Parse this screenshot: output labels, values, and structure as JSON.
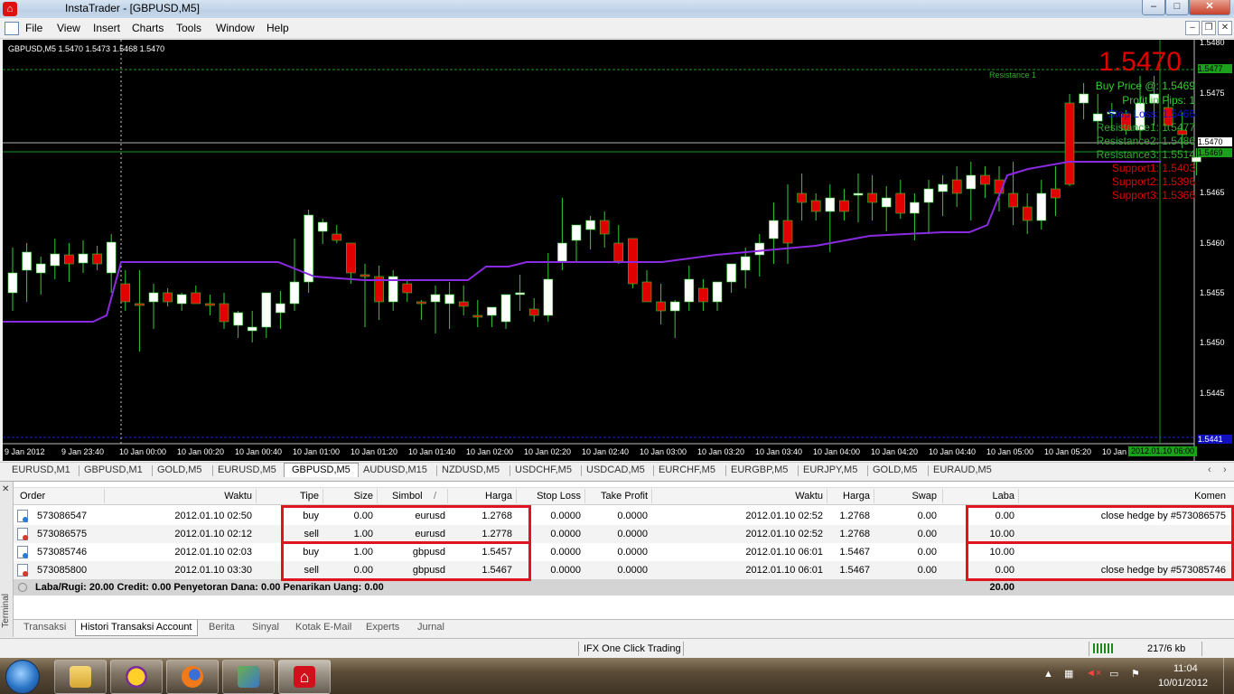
{
  "window": {
    "title": "InstaTrader - [GBPUSD,M5]"
  },
  "menu": [
    "File",
    "View",
    "Insert",
    "Charts",
    "Tools",
    "Window",
    "Help"
  ],
  "chart": {
    "info": "GBPUSD,M5  1.5470 1.5473 1.5468 1.5470",
    "big_price": "1.5470",
    "resistance_line_label": "Resistance 1",
    "annotations": [
      {
        "text": "Buy Price @: 1.5469",
        "color": "#33cc33"
      },
      {
        "text": "Profit in Pips: 1",
        "color": "#33cc33"
      },
      {
        "text": "Stop Loss: 1.5466",
        "color": "#1010e0"
      },
      {
        "text": "Resistance1: 1.5477",
        "color": "#33aa33"
      },
      {
        "text": "Resistance2: 1.5486",
        "color": "#33aa33"
      },
      {
        "text": "Resistance3: 1.5514",
        "color": "#33aa33"
      },
      {
        "text": "Support1: 1.5403",
        "color": "#e00000"
      },
      {
        "text": "Support2: 1.5396",
        "color": "#e00000"
      },
      {
        "text": "Support3: 1.5366",
        "color": "#e00000"
      }
    ],
    "price_axis": [
      "1.5480",
      "1.5475",
      "1.5470",
      "1.5465",
      "1.5460",
      "1.5455",
      "1.5450",
      "1.5445"
    ],
    "price_tags": [
      {
        "text": "1.5477",
        "bg": "#1aa01a",
        "color": "#000"
      },
      {
        "text": "1.5470",
        "bg": "#ffffff",
        "color": "#000"
      },
      {
        "text": "1.5469",
        "bg": "#1aa01a",
        "color": "#000"
      },
      {
        "text": "1.5441",
        "bg": "#1010c0",
        "color": "#fff"
      }
    ],
    "time_axis": [
      "9 Jan 2012",
      "9 Jan 23:40",
      "10 Jan 00:00",
      "10 Jan 00:20",
      "10 Jan 00:40",
      "10 Jan 01:00",
      "10 Jan 01:20",
      "10 Jan 01:40",
      "10 Jan 02:00",
      "10 Jan 02:20",
      "10 Jan 02:40",
      "10 Jan 03:00",
      "10 Jan 03:20",
      "10 Jan 03:40",
      "10 Jan 04:00",
      "10 Jan 04:20",
      "10 Jan 04:40",
      "10 Jan 05:00",
      "10 Jan 05:20",
      "10 Jan"
    ],
    "time_cursor": "2012.01.10 06:00",
    "colors": {
      "bull": "#ffffff",
      "bear": "#e00000",
      "wick": "#33cc33",
      "indicator": "#8a2be2"
    }
  },
  "chart_tabs": [
    "EURUSD,M1",
    "GBPUSD,M1",
    "GOLD,M5",
    "EURUSD,M5",
    "GBPUSD,M5",
    "AUDUSD,M15",
    "NZDUSD,M5",
    "USDCHF,M5",
    "USDCAD,M5",
    "EURCHF,M5",
    "EURGBP,M5",
    "EURJPY,M5",
    "GOLD,M5",
    "EURAUD,M5"
  ],
  "active_chart_tab": "GBPUSD,M5",
  "terminal": {
    "side_label": "Terminal",
    "columns": [
      "Order",
      "Waktu",
      "Tipe",
      "Size",
      "Simbol",
      "Harga",
      "Stop Loss",
      "Take Profit",
      "Waktu",
      "Harga",
      "Swap",
      "Laba",
      "Komen"
    ],
    "sort_indicator": "/",
    "rows": [
      {
        "order": "573086547",
        "time": "2012.01.10 02:50",
        "type": "buy",
        "size": "0.00",
        "symbol": "eurusd",
        "price": "1.2768",
        "sl": "0.0000",
        "tp": "0.0000",
        "close_time": "2012.01.10 02:52",
        "close_price": "1.2768",
        "swap": "0.00",
        "profit": "0.00",
        "comment": "close hedge by #573086575",
        "icon": "buy"
      },
      {
        "order": "573086575",
        "time": "2012.01.10 02:12",
        "type": "sell",
        "size": "1.00",
        "symbol": "eurusd",
        "price": "1.2778",
        "sl": "0.0000",
        "tp": "0.0000",
        "close_time": "2012.01.10 02:52",
        "close_price": "1.2768",
        "swap": "0.00",
        "profit": "10.00",
        "comment": "",
        "icon": "sell"
      },
      {
        "order": "573085746",
        "time": "2012.01.10 02:03",
        "type": "buy",
        "size": "1.00",
        "symbol": "gbpusd",
        "price": "1.5457",
        "sl": "0.0000",
        "tp": "0.0000",
        "close_time": "2012.01.10 06:01",
        "close_price": "1.5467",
        "swap": "0.00",
        "profit": "10.00",
        "comment": "",
        "icon": "buy"
      },
      {
        "order": "573085800",
        "time": "2012.01.10 03:30",
        "type": "sell",
        "size": "0.00",
        "symbol": "gbpusd",
        "price": "1.5467",
        "sl": "0.0000",
        "tp": "0.0000",
        "close_time": "2012.01.10 06:01",
        "close_price": "1.5467",
        "swap": "0.00",
        "profit": "0.00",
        "comment": "close hedge by #573085746",
        "icon": "sell"
      }
    ],
    "summary": "Laba/Rugi: 20.00  Credit: 0.00  Penyetoran Dana: 0.00  Penarikan Uang: 0.00",
    "summary_total": "20.00",
    "tabs": [
      "Transaksi",
      "Histori Transaksi Account",
      "Berita",
      "Sinyal",
      "Kotak E-Mail",
      "Experts",
      "Jurnal"
    ],
    "active_tab": "Histori Transaksi Account"
  },
  "status": {
    "center": "IFX One Click Trading",
    "traffic": "217/6 kb"
  },
  "taskbar": {
    "time": "11:04",
    "date": "10/01/2012"
  }
}
